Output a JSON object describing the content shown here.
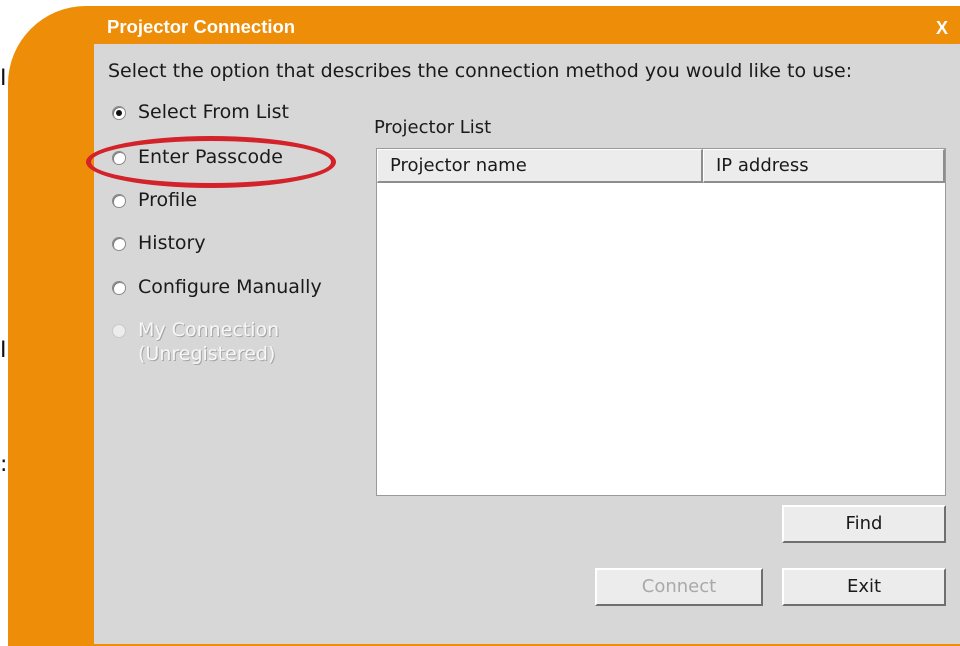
{
  "window": {
    "title": "Projector Connection",
    "close_label": "X"
  },
  "background": {
    "fragments": [
      "I",
      "I",
      ":"
    ]
  },
  "instruction": "Select the option that describes the connection method you would like to use:",
  "methods": [
    {
      "label": "Select From List",
      "selected": true,
      "enabled": true
    },
    {
      "label": "Enter Passcode",
      "selected": false,
      "enabled": true
    },
    {
      "label": "Profile",
      "selected": false,
      "enabled": true
    },
    {
      "label": "History",
      "selected": false,
      "enabled": true
    },
    {
      "label": "Configure Manually",
      "selected": false,
      "enabled": true
    },
    {
      "label_line1": "My Connection",
      "label_line2": "(Unregistered)",
      "selected": false,
      "enabled": false
    }
  ],
  "projector_list": {
    "caption": "Projector List",
    "columns": [
      "Projector name",
      "IP address"
    ],
    "rows": []
  },
  "buttons": {
    "find": "Find",
    "connect": "Connect",
    "exit": "Exit"
  },
  "colors": {
    "frame_orange": "#ee8d07",
    "client_gray": "#d7d7d7",
    "highlight_red": "#d3222a"
  }
}
